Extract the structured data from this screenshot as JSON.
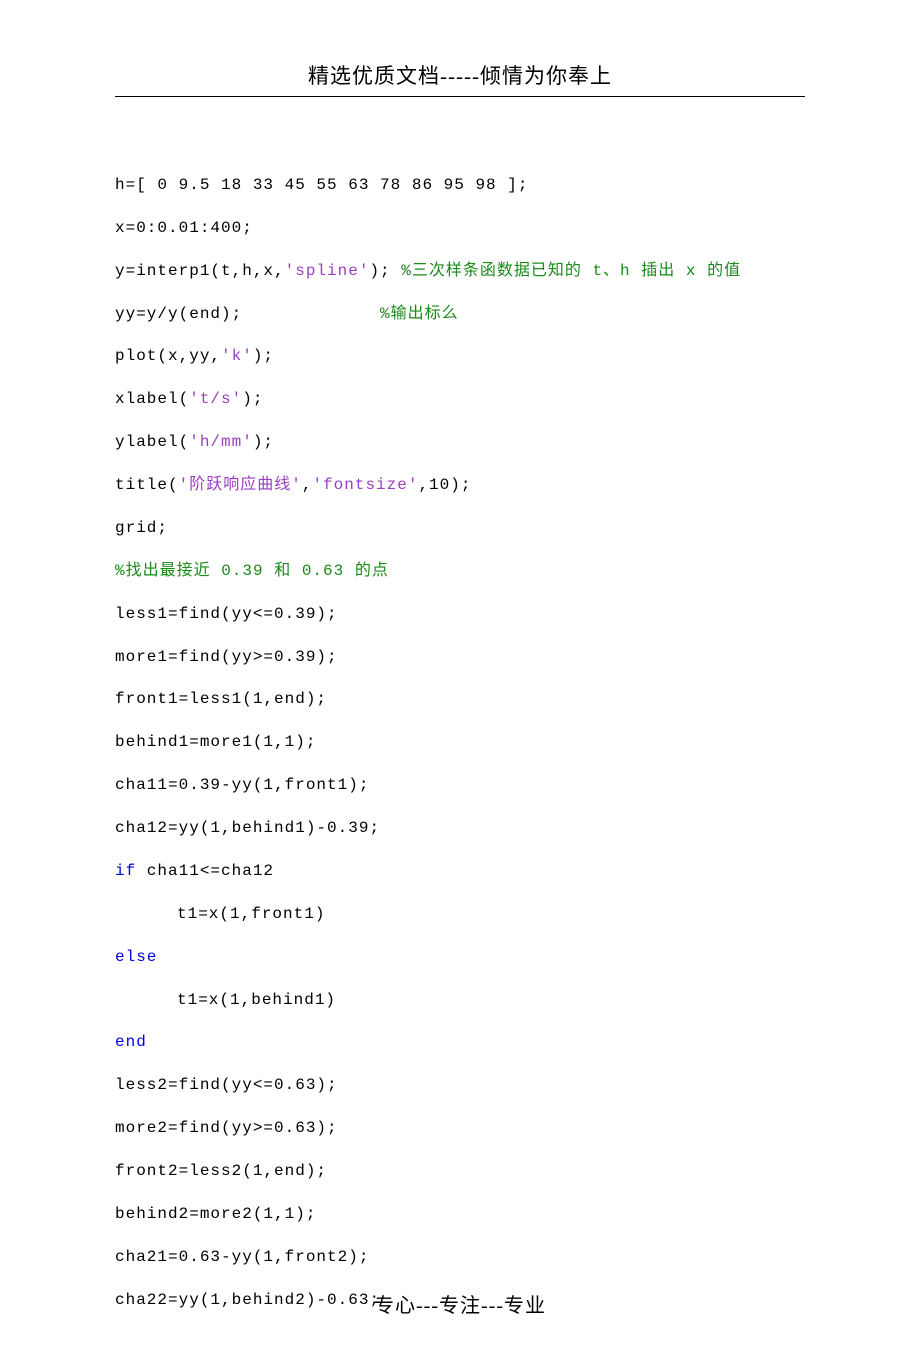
{
  "header": "精选优质文档-----倾情为你奉上",
  "footer": "专心---专注---专业",
  "code": {
    "l1": "h=[ 0 9.5 18 33 45 55 63 78 86 95 98 ];",
    "l2": "x=0:0.01:400;",
    "l3a": "y=interp1(t,h,x,",
    "l3b": "'spline'",
    "l3c": "); ",
    "l3d": "%三次样条函数据已知的 t、h 插出 x 的值",
    "l4a": "yy=y/y(end);             ",
    "l4b": "%输出标么",
    "l5a": "plot(x,yy,",
    "l5b": "'k'",
    "l5c": ");",
    "l6a": "xlabel(",
    "l6b": "'t/s'",
    "l6c": ");",
    "l7a": "ylabel(",
    "l7b": "'h/mm'",
    "l7c": ");",
    "l8a": "title(",
    "l8b": "'阶跃响应曲线'",
    "l8c": ",",
    "l8d": "'fontsize'",
    "l8e": ",10);",
    "l9": "grid;",
    "l10": "%找出最接近 0.39 和 0.63 的点",
    "l11": "less1=find(yy<=0.39);",
    "l12": "more1=find(yy>=0.39);",
    "l13": "front1=less1(1,end);",
    "l14": "behind1=more1(1,1);",
    "l15": "cha11=0.39-yy(1,front1);",
    "l16": "cha12=yy(1,behind1)-0.39;",
    "l17a": "if",
    "l17b": " cha11<=cha12",
    "l18": "t1=x(1,front1)",
    "l19": "else",
    "l20": "t1=x(1,behind1)",
    "l21": "end",
    "l22": "less2=find(yy<=0.63);",
    "l23": "more2=find(yy>=0.63);",
    "l24": "front2=less2(1,end);",
    "l25": "behind2=more2(1,1);",
    "l26": "cha21=0.63-yy(1,front2);",
    "l27": "cha22=yy(1,behind2)-0.63;"
  }
}
